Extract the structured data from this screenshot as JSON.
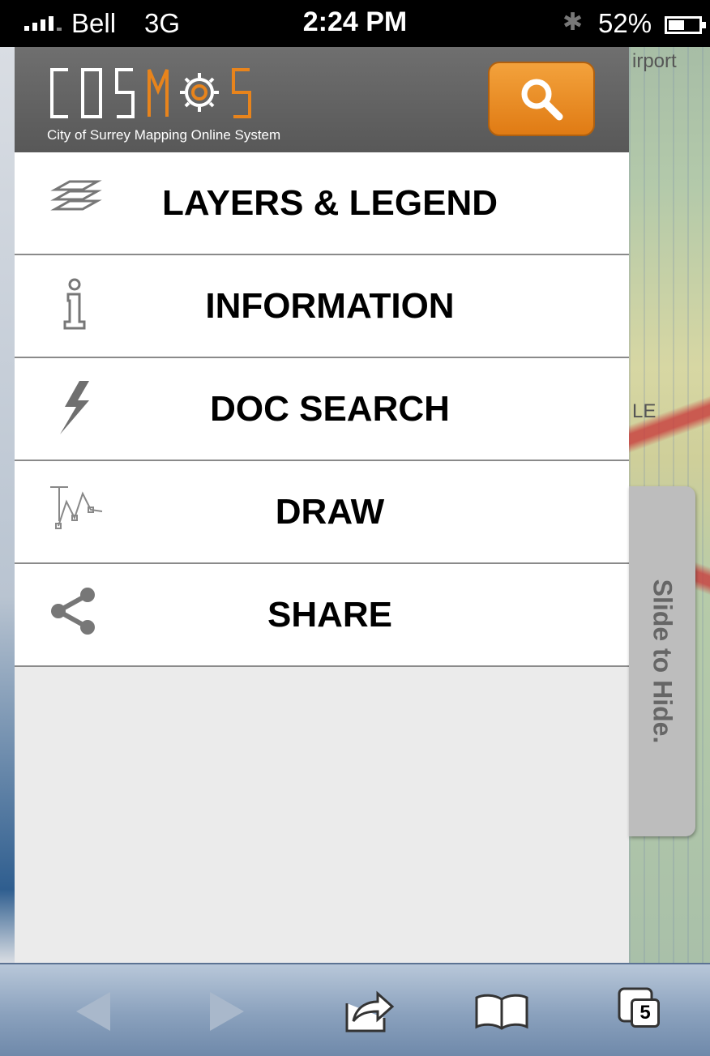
{
  "status_bar": {
    "carrier": "Bell",
    "network": "3G",
    "time": "2:24 PM",
    "battery": "52%",
    "battery_level": 0.52
  },
  "header": {
    "logo_text": "COSMOS",
    "logo_subtitle": "City of Surrey Mapping Online System",
    "search_icon": "magnifier-icon"
  },
  "menu": {
    "items": [
      {
        "label": "LAYERS & LEGEND",
        "icon": "layers-icon"
      },
      {
        "label": "INFORMATION",
        "icon": "info-icon"
      },
      {
        "label": "DOC SEARCH",
        "icon": "lightning-icon"
      },
      {
        "label": "DRAW",
        "icon": "draw-icon"
      },
      {
        "label": "SHARE",
        "icon": "share-icon"
      }
    ]
  },
  "slide_tab": {
    "label": "Slide to Hide."
  },
  "map": {
    "label_top": "irport",
    "label_mid": "LE"
  },
  "toolbar": {
    "tab_count": "5",
    "buttons": [
      "back-icon",
      "forward-icon",
      "share-action-icon",
      "bookmarks-icon",
      "tabs-icon"
    ]
  },
  "colors": {
    "accent_orange": "#e8841c",
    "header_gray": "#646464",
    "panel_bg": "#ebebeb"
  }
}
